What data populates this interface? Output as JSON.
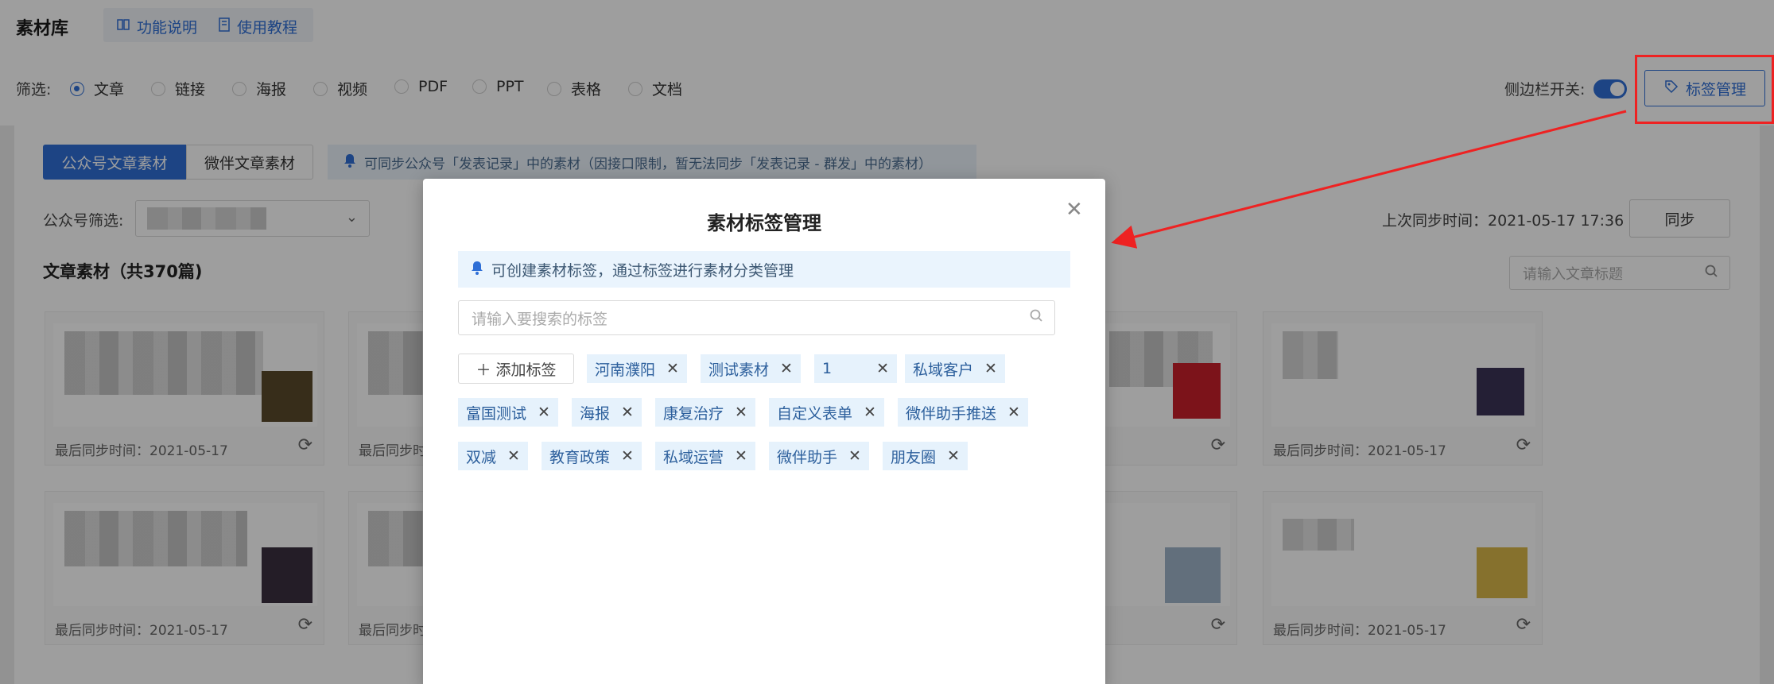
{
  "header": {
    "title": "素材库",
    "links": [
      {
        "label": "功能说明",
        "icon": "book-icon"
      },
      {
        "label": "使用教程",
        "icon": "document-icon"
      }
    ]
  },
  "filter": {
    "label": "筛选:",
    "options": [
      "文章",
      "链接",
      "海报",
      "视频",
      "PDF",
      "PPT",
      "表格",
      "文档"
    ],
    "selected": "文章",
    "sidebar_label": "侧边栏开关:",
    "sidebar_on": true,
    "tag_button": "标签管理"
  },
  "tabs": [
    "公众号文章素材",
    "微伴文章素材"
  ],
  "notice": "可同步公众号「发表记录」中的素材（因接口限制，暂无法同步「发表记录 - 群发」中的素材）",
  "account_filter_label": "公众号筛选:",
  "section_title": "文章素材（共370篇)",
  "last_sync": "上次同步时间：2021-05-17 17:36",
  "sync_button": "同步",
  "article_search_placeholder": "请输入文章标题",
  "cards": [
    {
      "date": "最后同步时间：2021-05-17"
    },
    {
      "date": "最后同步时"
    },
    {
      "date": "05-17"
    },
    {
      "date": "最后同步时间：2021-05-17"
    },
    {
      "date": "最后同步时间：2021-05-17"
    },
    {
      "date": "最后同步时"
    },
    {
      "date": "05-17"
    },
    {
      "date": "最后同步时间：2021-05-17"
    }
  ],
  "modal": {
    "title": "素材标签管理",
    "notice": "可创建素材标签，通过标签进行素材分类管理",
    "search_placeholder": "请输入要搜索的标签",
    "add_label": "添加标签",
    "tags": [
      "河南濮阳",
      "测试素材",
      "1",
      "私域客户",
      "富国测试",
      "海报",
      "康复治疗",
      "自定义表单",
      "微伴助手推送",
      "双减",
      "教育政策",
      "私域运营",
      "微伴助手",
      "朋友圈"
    ]
  },
  "colors": {
    "accent": "#2f6fd6",
    "highlight_box": "#ee2222",
    "tag_bg": "#e6f2fc"
  }
}
